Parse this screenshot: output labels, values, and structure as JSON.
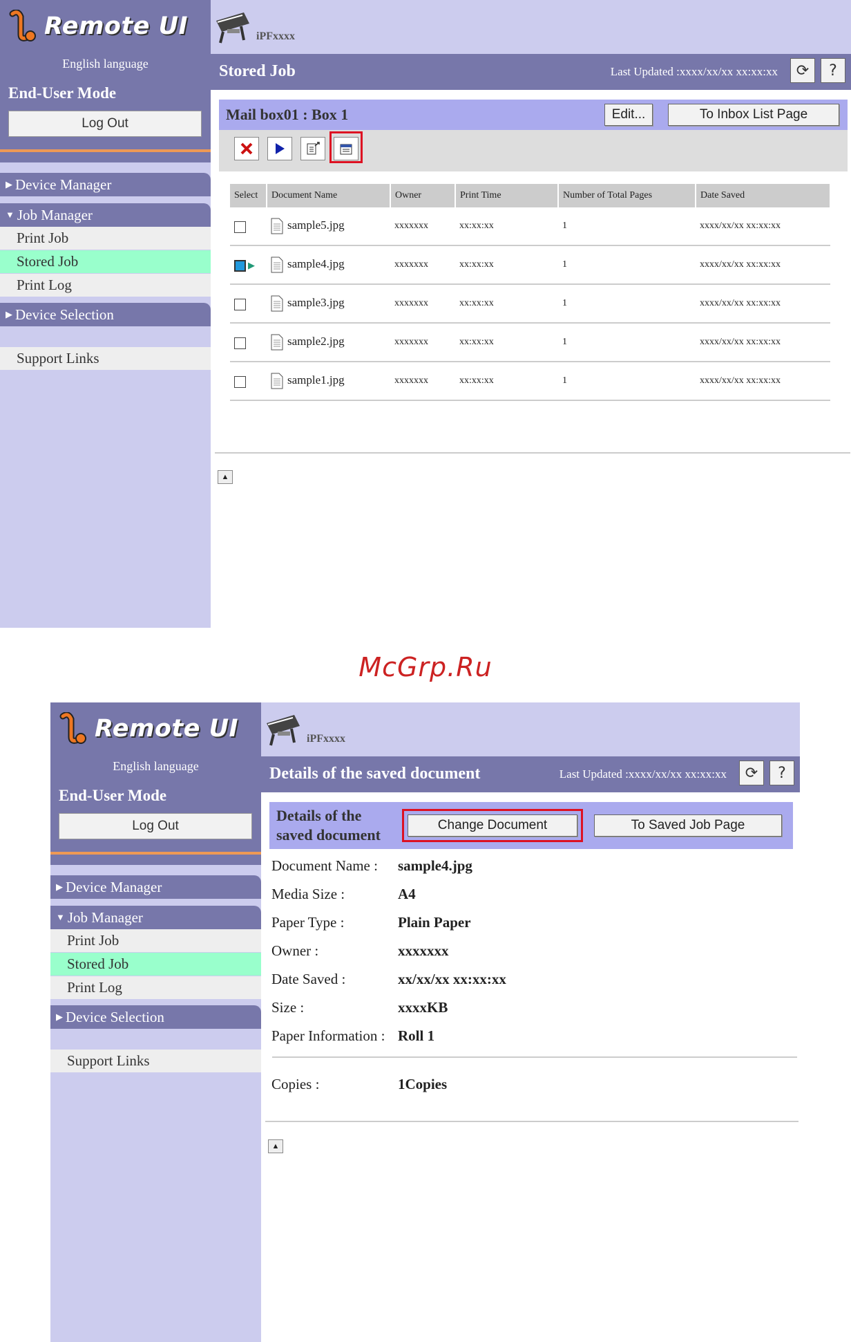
{
  "common": {
    "app_name": "Remote UI",
    "language": "English language",
    "mode": "End-User Mode",
    "logout_label": "Log Out",
    "model": "iPFxxxx",
    "last_updated": "Last Updated :xxxx/xx/xx xx:xx:xx",
    "refresh_icon": "refresh-icon",
    "help_label": "?",
    "nav": {
      "device_manager": "Device Manager",
      "job_manager": "Job Manager",
      "print_job": "Print Job",
      "stored_job": "Stored Job",
      "print_log": "Print Log",
      "device_selection": "Device Selection",
      "support_links": "Support Links"
    },
    "colors": {
      "header": "#7777aa",
      "sidebar": "#ccccee",
      "active": "#99ffcc",
      "highlight": "#dd1122"
    }
  },
  "screen1": {
    "page_title": "Stored Job",
    "box_title": "Mail box01 : Box 1",
    "edit_label": "Edit...",
    "inbox_label": "To Inbox List Page",
    "toolbar_icons": [
      "delete-icon",
      "print-icon",
      "move-icon",
      "details-icon"
    ],
    "columns": [
      "Select",
      "Document Name",
      "Owner",
      "Print Time",
      "Number of Total Pages",
      "Date Saved"
    ],
    "rows": [
      {
        "name": "sample5.jpg",
        "owner": "xxxxxxx",
        "time": "xx:xx:xx",
        "pages": "1",
        "date": "xxxx/xx/xx xx:xx:xx",
        "selected": false
      },
      {
        "name": "sample4.jpg",
        "owner": "xxxxxxx",
        "time": "xx:xx:xx",
        "pages": "1",
        "date": "xxxx/xx/xx xx:xx:xx",
        "selected": true
      },
      {
        "name": "sample3.jpg",
        "owner": "xxxxxxx",
        "time": "xx:xx:xx",
        "pages": "1",
        "date": "xxxx/xx/xx xx:xx:xx",
        "selected": false
      },
      {
        "name": "sample2.jpg",
        "owner": "xxxxxxx",
        "time": "xx:xx:xx",
        "pages": "1",
        "date": "xxxx/xx/xx xx:xx:xx",
        "selected": false
      },
      {
        "name": "sample1.jpg",
        "owner": "xxxxxxx",
        "time": "xx:xx:xx",
        "pages": "1",
        "date": "xxxx/xx/xx xx:xx:xx",
        "selected": false
      }
    ]
  },
  "watermark": "McGrp.Ru",
  "screen2": {
    "page_title": "Details of the saved document",
    "section_title_1": "Details of the",
    "section_title_2": "saved document",
    "change_label": "Change Document",
    "back_label": "To Saved Job Page",
    "details": [
      {
        "key": "Document Name :",
        "value": "sample4.jpg"
      },
      {
        "key": "Media Size :",
        "value": "A4"
      },
      {
        "key": "Paper Type :",
        "value": "Plain Paper"
      },
      {
        "key": "Owner :",
        "value": "xxxxxxx"
      },
      {
        "key": "Date Saved :",
        "value": "xx/xx/xx xx:xx:xx"
      },
      {
        "key": "Size :",
        "value": "xxxxKB"
      },
      {
        "key": "Paper Information :",
        "value": "Roll 1"
      }
    ],
    "copies_key": "Copies :",
    "copies_value": "1Copies"
  }
}
